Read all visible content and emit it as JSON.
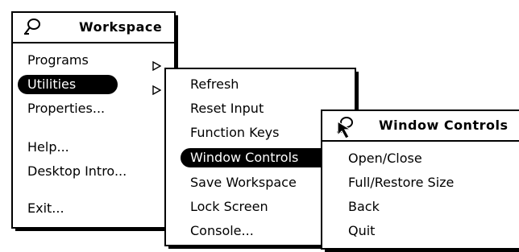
{
  "workspace_menu": {
    "title": "Workspace",
    "pin_icon": "pushpin-icon",
    "items": [
      {
        "label": "Programs",
        "submenu": true
      },
      {
        "label": "Utilities",
        "submenu": true,
        "highlighted": true
      },
      {
        "label": "Properties..."
      },
      {
        "label": "Help..."
      },
      {
        "label": "Desktop Intro..."
      },
      {
        "label": "Exit..."
      }
    ]
  },
  "utilities_menu": {
    "items": [
      {
        "label": "Refresh"
      },
      {
        "label": "Reset Input"
      },
      {
        "label": "Function Keys"
      },
      {
        "label": "Window Controls",
        "submenu": true,
        "highlighted": true
      },
      {
        "label": "Save Workspace"
      },
      {
        "label": "Lock Screen"
      },
      {
        "label": "Console..."
      }
    ]
  },
  "window_controls_menu": {
    "title": "Window Controls",
    "pin_icon": "pushpin-icon",
    "items": [
      {
        "label": "Open/Close"
      },
      {
        "label": "Full/Restore Size"
      },
      {
        "label": "Back"
      },
      {
        "label": "Quit"
      }
    ]
  },
  "colors": {
    "background": "#ffffff",
    "foreground": "#000000",
    "highlight": "#000000"
  }
}
